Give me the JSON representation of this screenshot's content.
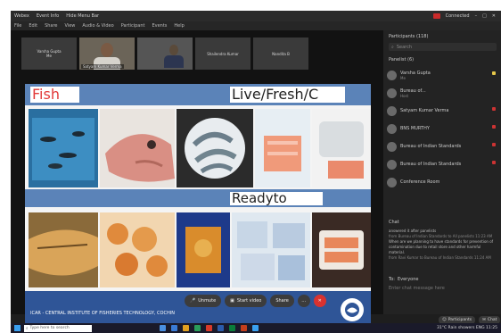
{
  "window": {
    "tabs": [
      "Webex",
      "Event Info",
      "Hide Menu Bar"
    ],
    "connection_status": "Connected",
    "menu": [
      "File",
      "Edit",
      "Share",
      "View",
      "Audio & Video",
      "Participant",
      "Events",
      "Help"
    ]
  },
  "video_tiles": [
    {
      "label": "Varsha Gupta",
      "sub": "Me"
    },
    {
      "label": "Satyam Kumar Verma",
      "video": true
    },
    {
      "label": "",
      "video2": true
    },
    {
      "label": "Shailendra Kumar"
    },
    {
      "label": "Nandita B"
    }
  ],
  "slide": {
    "title_left": "Fish",
    "title_right": "Live/Fresh/C",
    "subtitle": "Readyto",
    "footer": "ICAR - CENTRAL INSTITUTE OF FISHERIES TECHNOLOGY, COCHIN"
  },
  "controls": {
    "unmute": "Unmute",
    "start_video": "Start video",
    "share": "Share",
    "more": "…"
  },
  "panel": {
    "title": "Participants (118)",
    "search_placeholder": "Search",
    "panelist_header": "Panelist (6)",
    "panelists": [
      {
        "name": "Varsha Gupta",
        "role": "Me",
        "ind": "#e6c84a"
      },
      {
        "name": "Bureau of...",
        "role": "Host",
        "ind": ""
      },
      {
        "name": "Satyam Kumar Verma",
        "role": "",
        "ind": "#cc3333"
      },
      {
        "name": "BNS MURTHY",
        "role": "",
        "ind": "#cc3333"
      },
      {
        "name": "Bureau of Indian Standards",
        "role": "",
        "ind": "#cc3333"
      },
      {
        "name": "Bureau of Indian Standards",
        "role": "",
        "ind": "#cc3333"
      },
      {
        "name": "Conference Room",
        "role": "",
        "ind": ""
      }
    ],
    "chat_header": "Chat",
    "chat_lines": [
      "answered it after panelists",
      "from Bureau of Indian Standards to All panelists  11:23 AM",
      "When are we planning to have standards for prevention of contamination due to retail store and other harmful material.",
      "from Ravi Kumar to Bureau of Indian Standards  11:24 AM"
    ],
    "to_label": "To:",
    "to_value": "Everyone",
    "chat_placeholder": "Enter chat message here",
    "btn_participants": "Participants",
    "btn_chat": "Chat"
  },
  "taskbar": {
    "search": "Type here to search",
    "tray": "31°C  Rain showers  ENG  11:25"
  },
  "colors": {
    "slide_band": "#5b83b8",
    "footer": "#2f5597",
    "end_button": "#d9322f"
  }
}
